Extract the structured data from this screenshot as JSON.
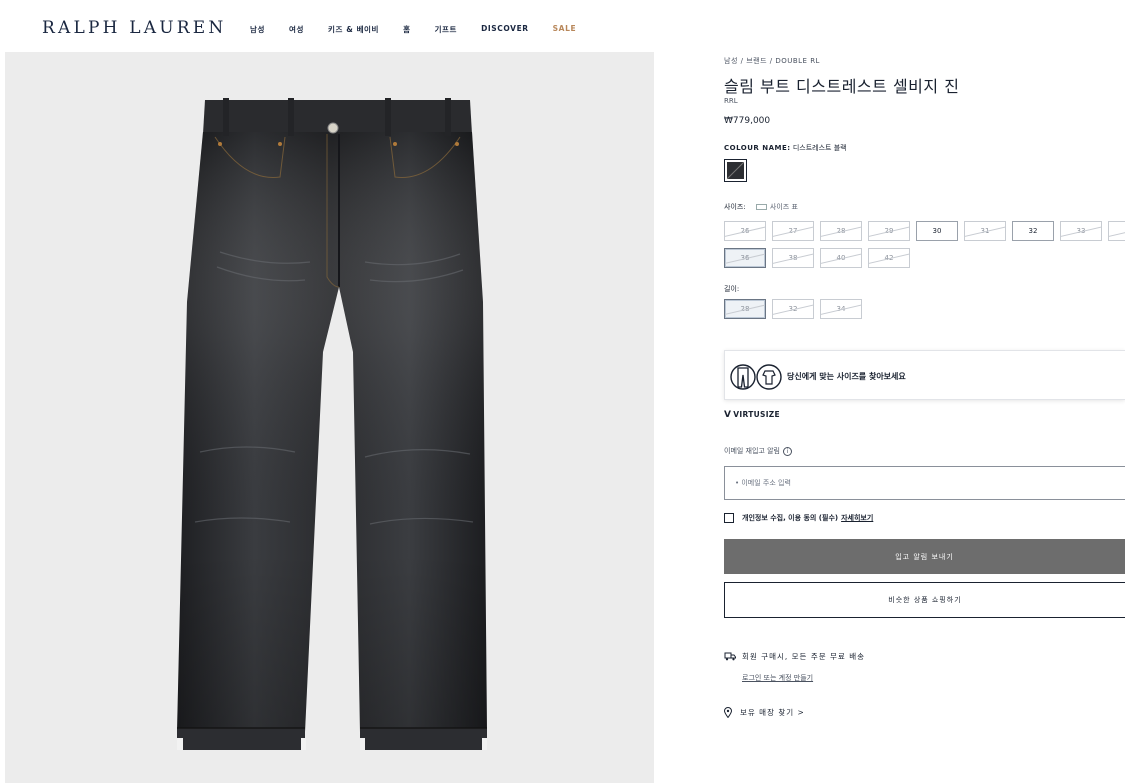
{
  "header": {
    "logo": "RALPH LAUREN",
    "nav": [
      {
        "label": "남성"
      },
      {
        "label": "여성"
      },
      {
        "label": "키즈 & 베이비"
      },
      {
        "label": "홈"
      },
      {
        "label": "기프트"
      },
      {
        "label": "DISCOVER"
      },
      {
        "label": "SALE"
      }
    ]
  },
  "product": {
    "breadcrumb": "남성 / 브랜드 / DOUBLE RL",
    "title": "슬림 부트 디스트레스트 셀비지 진",
    "brand": "RRL",
    "price": "₩779,000",
    "colour_label": "COLOUR NAME:",
    "colour_value": "디스트레스트 블랙",
    "size_label": "사이즈:",
    "size_guide": "사이즈 표",
    "sizes_row1": [
      {
        "label": "26",
        "state": "oos"
      },
      {
        "label": "27",
        "state": "oos"
      },
      {
        "label": "28",
        "state": "oos"
      },
      {
        "label": "29",
        "state": "oos"
      },
      {
        "label": "30",
        "state": "avail"
      },
      {
        "label": "31",
        "state": "oos"
      },
      {
        "label": "32",
        "state": "avail"
      },
      {
        "label": "33",
        "state": "oos"
      },
      {
        "label": "34",
        "state": "oos"
      }
    ],
    "sizes_row2": [
      {
        "label": "36",
        "state": "selected-oos"
      },
      {
        "label": "38",
        "state": "oos"
      },
      {
        "label": "40",
        "state": "oos"
      },
      {
        "label": "42",
        "state": "oos"
      }
    ],
    "inseam_label": "길이:",
    "inseams": [
      {
        "label": "28",
        "state": "selected-oos"
      },
      {
        "label": "32",
        "state": "oos"
      },
      {
        "label": "34",
        "state": "oos"
      }
    ]
  },
  "virtusize": {
    "prompt": "당신에게 맞는 사이즈를 찾아보세요",
    "brand": "VIRTUSIZE"
  },
  "notify": {
    "label": "이메일 재입고 알림",
    "info": "i",
    "email_placeholder": "• 이메일 주소 입력",
    "consent_text": "개인정보 수집, 이용 동의 (필수)",
    "consent_link": "자세히보기",
    "primary_button": "입고 알림 보내기",
    "secondary_button": "비슷한 상품 쇼핑하기"
  },
  "shipping": {
    "text": "회원 구매시, 모든 주문 무료 배송",
    "login": "로그인 또는 계정 만들기"
  },
  "store": {
    "text": "보유 매장 찾기 >"
  },
  "colors": {
    "sale": "#b8875a",
    "navy": "#1a2740",
    "button_gray": "#6d6d6d",
    "image_bg": "#ececec"
  }
}
